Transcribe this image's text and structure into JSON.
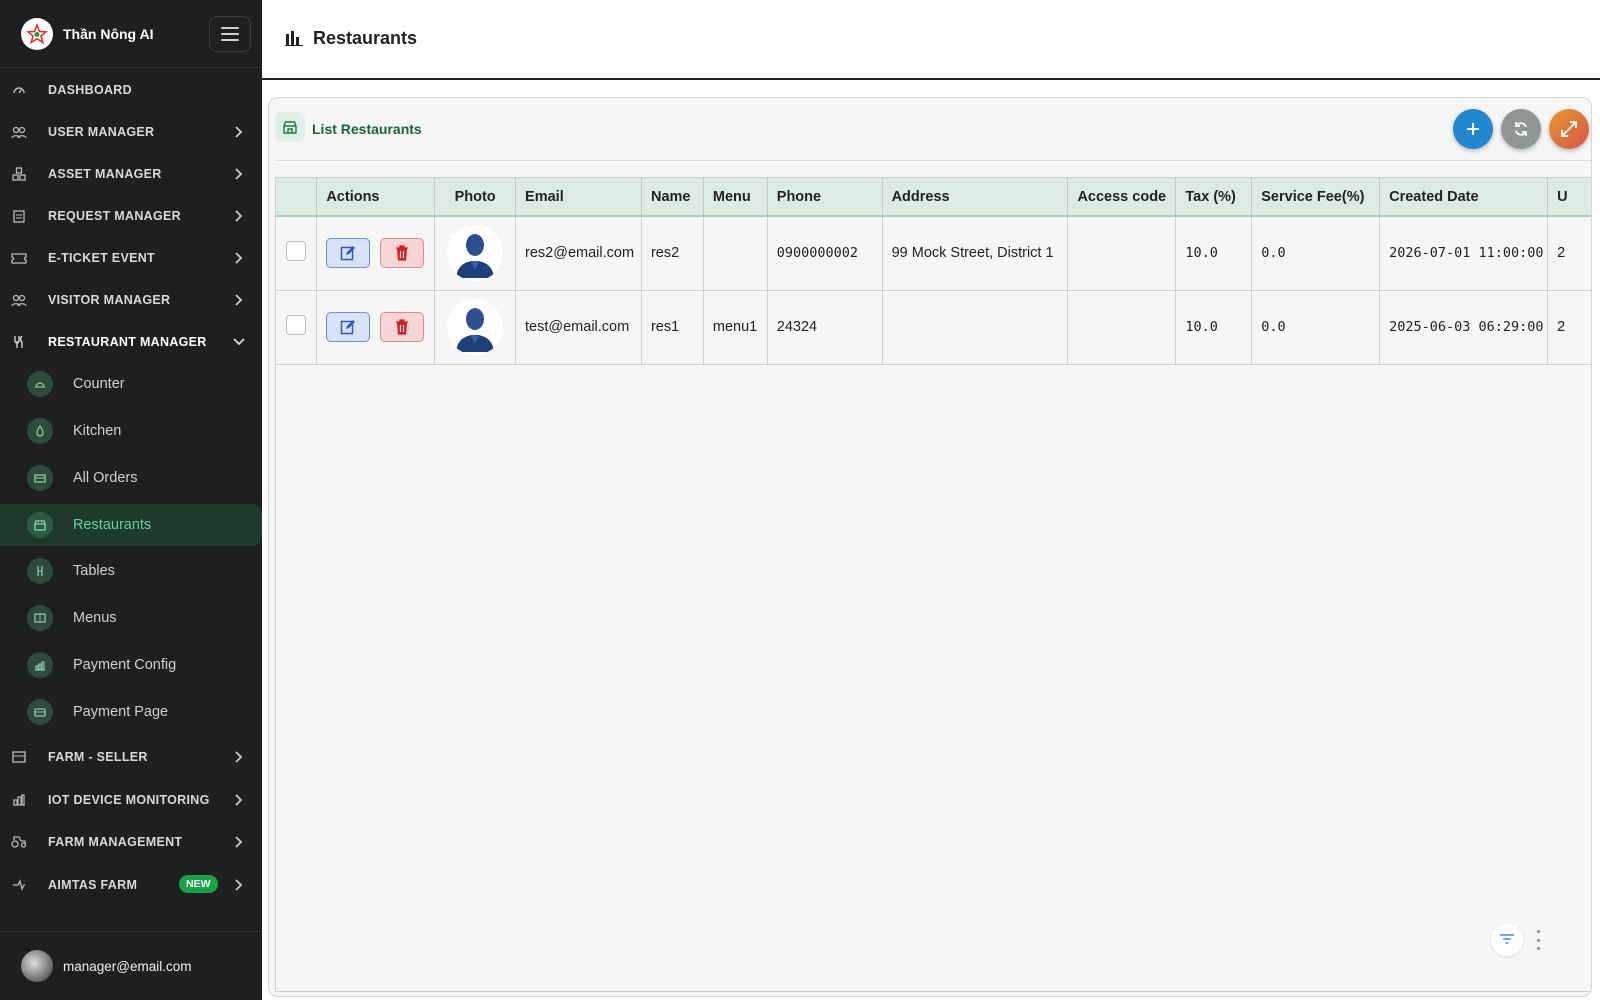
{
  "app": {
    "name": "Thần Nông AI"
  },
  "sidebar": {
    "items": [
      {
        "label": "DASHBOARD",
        "icon": "dashboard-icon",
        "chevron": false
      },
      {
        "label": "USER MANAGER",
        "icon": "users-icon",
        "chevron": true
      },
      {
        "label": "ASSET MANAGER",
        "icon": "asset-icon",
        "chevron": true
      },
      {
        "label": "REQUEST MANAGER",
        "icon": "clipboard-icon",
        "chevron": true
      },
      {
        "label": "E-TICKET EVENT",
        "icon": "ticket-icon",
        "chevron": true
      },
      {
        "label": "VISITOR MANAGER",
        "icon": "visitor-icon",
        "chevron": true
      },
      {
        "label": "RESTAURANT MANAGER",
        "icon": "utensils-icon",
        "chevron": "down"
      }
    ],
    "sub_items": [
      {
        "label": "Counter",
        "icon": "counter-icon"
      },
      {
        "label": "Kitchen",
        "icon": "kitchen-icon"
      },
      {
        "label": "All Orders",
        "icon": "orders-icon"
      },
      {
        "label": "Restaurants",
        "icon": "store-icon",
        "active": true
      },
      {
        "label": "Tables",
        "icon": "table-icon"
      },
      {
        "label": "Menus",
        "icon": "menu-book-icon"
      },
      {
        "label": "Payment Config",
        "icon": "payment-config-icon"
      },
      {
        "label": "Payment Page",
        "icon": "card-icon"
      }
    ],
    "bottom_items": [
      {
        "label": "FARM - SELLER",
        "icon": "seller-icon"
      },
      {
        "label": "IOT DEVICE MONITORING",
        "icon": "iot-icon"
      },
      {
        "label": "FARM MANAGEMENT",
        "icon": "tractor-icon"
      },
      {
        "label": "AIMTAS FARM",
        "icon": "aimtas-icon",
        "badge": "NEW"
      }
    ],
    "user": {
      "email": "manager@email.com"
    }
  },
  "header": {
    "title": "Restaurants"
  },
  "card": {
    "title": "List Restaurants"
  },
  "table": {
    "columns": [
      "Actions",
      "Photo",
      "Email",
      "Name",
      "Menu",
      "Phone",
      "Address",
      "Access code",
      "Tax (%)",
      "Service Fee(%)",
      "Created Date",
      "U"
    ],
    "rows": [
      {
        "email": "res2@email.com",
        "name": "res2",
        "menu": "",
        "phone": "0900000002",
        "address": "99 Mock Street, District 1",
        "access_code": "",
        "tax": "10.0",
        "service_fee": "0.0",
        "created": "2026-07-01 11:00:00",
        "updated": "2"
      },
      {
        "email": "test@email.com",
        "name": "res1",
        "menu": "menu1",
        "phone": "24324",
        "address": "",
        "access_code": "",
        "tax": "10.0",
        "service_fee": "0.0",
        "created": "2025-06-03 06:29:00",
        "updated": "2"
      }
    ]
  },
  "colors": {
    "sidebar_bg": "#1e1f21",
    "accent_green": "#17633a",
    "active_text": "#5fd49a",
    "add_button": "#2188d0",
    "refresh_button": "#8e9796",
    "badge_new": "#1aa34a"
  }
}
